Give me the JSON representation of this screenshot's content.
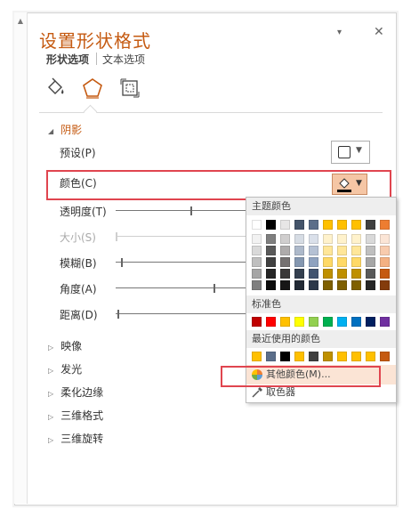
{
  "pane": {
    "title": "设置形状格式",
    "tabs": {
      "shape_options": "形状选项",
      "text_options": "文本选项"
    },
    "title_caret": "▾",
    "close": "✕",
    "scroll_up": "▲",
    "icons": [
      "fill-line-icon",
      "effects-icon",
      "size-properties-icon"
    ]
  },
  "shadow": {
    "section": "阴影",
    "expanded_glyph": "◢",
    "preset_label": "预设(P)",
    "color_label": "颜色(C)",
    "sliders": [
      {
        "label": "透明度(T)",
        "value": 0.42,
        "disabled": false
      },
      {
        "label": "大小(S)",
        "value": 0.0,
        "disabled": true
      },
      {
        "label": "模糊(B)",
        "value": 0.03,
        "disabled": false
      },
      {
        "label": "角度(A)",
        "value": 0.55,
        "disabled": false
      },
      {
        "label": "距离(D)",
        "value": 0.01,
        "disabled": false
      }
    ]
  },
  "collapsed_sections": [
    "映像",
    "发光",
    "柔化边缘",
    "三维格式",
    "三维旋转"
  ],
  "collapsed_glyph": "▷",
  "dropdown": {
    "theme_header": "主题颜色",
    "standard_header": "标准色",
    "recent_header": "最近使用的颜色",
    "more_colors": "其他颜色(M)...",
    "eyedropper": "取色器",
    "theme_top": [
      "#ffffff",
      "#000000",
      "#e7e6e6",
      "#44546a",
      "#5b6e8a",
      "#ffc000",
      "#ffc000",
      "#ffc000",
      "#404040",
      "#ed7d31"
    ],
    "theme_columns": [
      [
        "#f2f2f2",
        "#d9d9d9",
        "#bfbfbf",
        "#a6a6a6",
        "#808080"
      ],
      [
        "#7f7f7f",
        "#595959",
        "#404040",
        "#262626",
        "#0d0d0d"
      ],
      [
        "#d0cece",
        "#aeabab",
        "#757171",
        "#3a3838",
        "#171616"
      ],
      [
        "#d6dce4",
        "#adb9ca",
        "#8497b0",
        "#333f4f",
        "#222a35"
      ],
      [
        "#dae0ea",
        "#b5c1d4",
        "#8fa2bf",
        "#425470",
        "#2c384a"
      ],
      [
        "#fff2cc",
        "#ffe699",
        "#ffd966",
        "#bf9000",
        "#7f6000"
      ],
      [
        "#fff2cc",
        "#ffe699",
        "#ffd966",
        "#bf9000",
        "#7f6000"
      ],
      [
        "#fff2cc",
        "#ffe699",
        "#ffd966",
        "#bf9000",
        "#7f6000"
      ],
      [
        "#d9d9d9",
        "#bfbfbf",
        "#a6a6a6",
        "#595959",
        "#262626"
      ],
      [
        "#fbe5d6",
        "#f8cbad",
        "#f4b183",
        "#c55a11",
        "#843c0c"
      ]
    ],
    "standard_colors": [
      "#c00000",
      "#ff0000",
      "#ffc000",
      "#ffff00",
      "#92d050",
      "#00b050",
      "#00b0f0",
      "#0070c0",
      "#002060",
      "#7030a0"
    ],
    "recent_colors": [
      "#ffc000",
      "#5b6e8a",
      "#000000",
      "#ffc000",
      "#404040",
      "#bf9000",
      "#ffc000",
      "#ffc000",
      "#ffc000",
      "#c55a11"
    ]
  }
}
